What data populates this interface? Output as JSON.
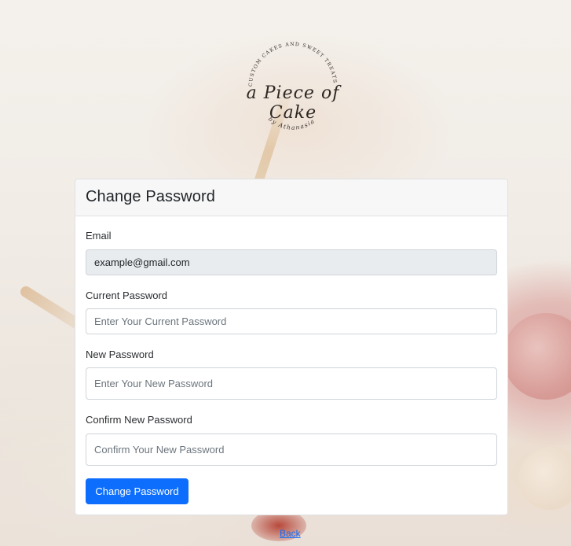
{
  "logo": {
    "arc_text": "CUSTOM CAKES AND SWEET TREATS",
    "main_text": "a Piece of Cake",
    "sub_text": "by Athanasia"
  },
  "card": {
    "title": "Change Password"
  },
  "form": {
    "email": {
      "label": "Email",
      "value": "example@gmail.com"
    },
    "current_password": {
      "label": "Current Password",
      "placeholder": "Enter Your Current Password"
    },
    "new_password": {
      "label": "New Password",
      "placeholder": "Enter Your New Password"
    },
    "confirm_password": {
      "label": "Confirm New Password",
      "placeholder": "Confirm Your New Password"
    },
    "submit_label": "Change Password"
  },
  "back_link": "Back",
  "colors": {
    "primary": "#0d6efd",
    "readonly_bg": "#e9ecef"
  }
}
